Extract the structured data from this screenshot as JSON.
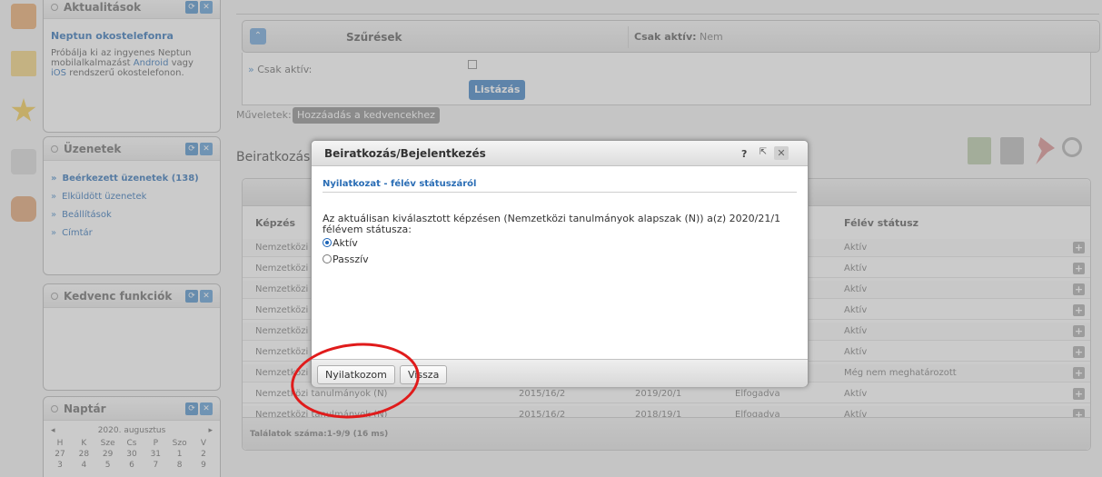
{
  "sidebar": {
    "news": {
      "title": "Aktualitások",
      "item_title": "Neptun okostelefonra",
      "text_1": "Próbálja ki az ingyenes Neptun mobilalkalmazást",
      "link_android": "Android",
      "text_2": "vagy",
      "link_ios": "iOS",
      "text_3": "rendszerű okostelefonon."
    },
    "messages": {
      "title": "Üzenetek",
      "items": [
        {
          "label": "Beérkezett üzenetek (138)"
        },
        {
          "label": "Elküldött üzenetek"
        },
        {
          "label": "Beállítások"
        },
        {
          "label": "Címtár"
        }
      ]
    },
    "favorites": {
      "title": "Kedvenc funkciók"
    },
    "calendar": {
      "title": "Naptár",
      "month": "2020. augusztus",
      "prev": "◂",
      "next": "▸",
      "days": [
        "H",
        "K",
        "Sze",
        "Cs",
        "P",
        "Szo",
        "V"
      ],
      "weeks": [
        [
          "27",
          "28",
          "29",
          "30",
          "31",
          "1",
          "2"
        ],
        [
          "3",
          "4",
          "5",
          "6",
          "7",
          "8",
          "9"
        ]
      ]
    }
  },
  "filters": {
    "title": "Szűrések",
    "active_label": "Csak aktív:",
    "active_value": "Nem",
    "field_label": "Csak aktív:",
    "list_button": "Listázás"
  },
  "operations": {
    "label": "Műveletek:",
    "add_favorite": "Hozzáadás a kedvencekhez"
  },
  "section": {
    "title": "Beiratkozás"
  },
  "grid": {
    "columns": {
      "kepzes": "Képzés",
      "felev_status": "Félév státusz"
    },
    "rows": [
      {
        "kepzes": "Nemzetközi",
        "col2": "",
        "col3": "",
        "col4": "",
        "status": "Aktív"
      },
      {
        "kepzes": "Nemzetközi",
        "col2": "",
        "col3": "",
        "col4": "",
        "status": "Aktív"
      },
      {
        "kepzes": "Nemzetközi",
        "col2": "",
        "col3": "",
        "col4": "",
        "status": "Aktív"
      },
      {
        "kepzes": "Nemzetközi",
        "col2": "",
        "col3": "",
        "col4": "",
        "status": "Aktív"
      },
      {
        "kepzes": "Nemzetközi",
        "col2": "",
        "col3": "",
        "col4": "",
        "status": "Aktív"
      },
      {
        "kepzes": "Nemzetközi",
        "col2": "",
        "col3": "",
        "col4": "",
        "status": "Aktív"
      },
      {
        "kepzes": "Nemzetközi",
        "col2": "",
        "col3": "",
        "col4": "",
        "status": "Még nem meghatározott"
      },
      {
        "kepzes": "Nemzetközi tanulmányok (N)",
        "col2": "2015/16/2",
        "col3": "2019/20/1",
        "col4": "Elfogadva",
        "status": "Aktív"
      },
      {
        "kepzes": "Nemzetközi tanulmányok (N)",
        "col2": "2015/16/2",
        "col3": "2018/19/1",
        "col4": "Elfogadva",
        "status": "Aktív"
      }
    ],
    "row_plus": "+",
    "footer": "Találatok száma:1-9/9 (16 ms)"
  },
  "dialog": {
    "title": "Beiratkozás/Bejelentkezés",
    "help": "?",
    "popout": "⇱",
    "close": "✕",
    "subtitle": "Nyilatkozat - félév státuszáról",
    "text": "Az aktuálisan kiválasztott képzésen (Nemzetközi tanulmányok alapszak (N)) a(z) 2020/21/1 félévem státusza:",
    "options": [
      {
        "label": "Aktív",
        "selected": true
      },
      {
        "label": "Passzív",
        "selected": false
      }
    ],
    "confirm_button": "Nyilatkozom",
    "back_button": "Vissza"
  },
  "colors": {
    "accent": "#2a6db5",
    "annotation": "#e01b1b"
  }
}
